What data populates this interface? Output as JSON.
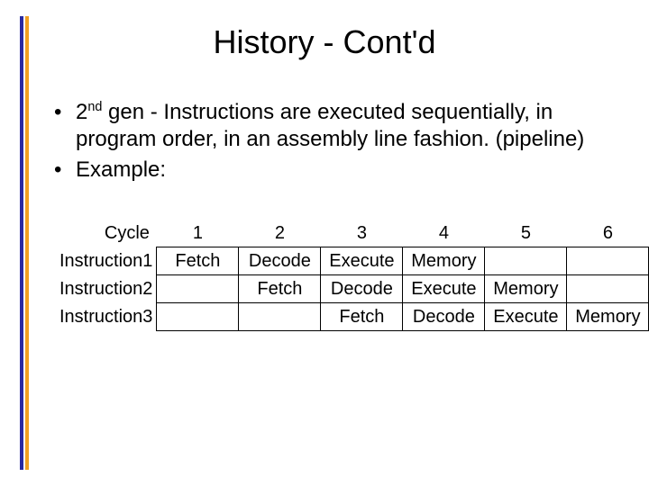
{
  "title": "History - Cont'd",
  "bullets": [
    {
      "pre": "2",
      "sup": "nd",
      "post": " gen - Instructions are executed sequentially, in program order, in an assembly line fashion. (pipeline)"
    },
    {
      "pre": "Example:",
      "sup": "",
      "post": ""
    }
  ],
  "chart_data": {
    "type": "table",
    "corner_label": "Cycle",
    "columns": [
      "1",
      "2",
      "3",
      "4",
      "5",
      "6"
    ],
    "rows": [
      {
        "label": "Instruction1",
        "cells": [
          "Fetch",
          "Decode",
          "Execute",
          "Memory",
          "",
          ""
        ]
      },
      {
        "label": "Instruction2",
        "cells": [
          "",
          "Fetch",
          "Decode",
          "Execute",
          "Memory",
          ""
        ]
      },
      {
        "label": "Instruction3",
        "cells": [
          "",
          "",
          "Fetch",
          "Decode",
          "Execute",
          "Memory"
        ]
      }
    ]
  }
}
